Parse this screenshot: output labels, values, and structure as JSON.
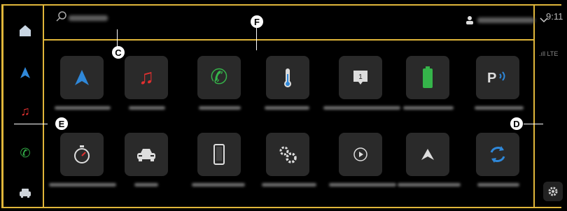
{
  "status": {
    "time": "9:11",
    "signal": "LTE"
  },
  "callouts": {
    "c": "C",
    "d": "D",
    "e": "E",
    "f": "F"
  },
  "sidebar": {
    "items": [
      {
        "name": "home-icon",
        "color": "#c9d6e3"
      },
      {
        "name": "navigation-icon",
        "color": "#2f88d9"
      },
      {
        "name": "music-icon",
        "color": "#e03030"
      },
      {
        "name": "phone-icon",
        "color": "#35b44a"
      },
      {
        "name": "car-icon",
        "color": "#cfd4da"
      }
    ]
  },
  "apps": {
    "row1": [
      "navigation-icon",
      "music-icon",
      "phone-icon",
      "climate-icon",
      "notification-icon",
      "battery-icon",
      "parking-icon"
    ],
    "row2": [
      "timer-icon",
      "car-icon",
      "phone-device-icon",
      "settings-icon",
      "play-icon",
      "android-auto-icon",
      "refresh-icon"
    ]
  },
  "colors": {
    "frame": "#e0b63a",
    "bg": "#000000",
    "tile": "#2a2a2a",
    "accent_blue": "#2f88d9",
    "accent_red": "#e03030",
    "accent_green": "#35b44a"
  }
}
